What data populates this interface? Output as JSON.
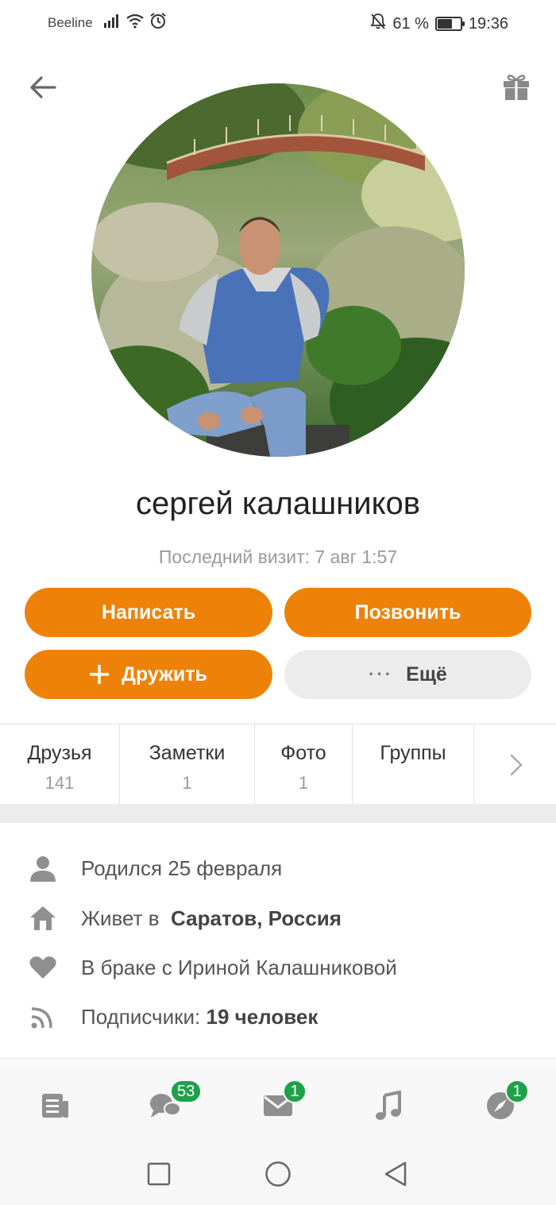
{
  "status_bar": {
    "carrier": "Beeline",
    "battery_percent": "61 %",
    "battery_level": 0.61,
    "time": "19:36"
  },
  "profile": {
    "name": "сергей калашников",
    "last_visit": "Последний визит: 7 авг 1:57"
  },
  "actions": {
    "write": "Написать",
    "call": "Позвонить",
    "befriend": "Дружить",
    "more": "Ещё"
  },
  "tabs": [
    {
      "label": "Друзья",
      "count": "141"
    },
    {
      "label": "Заметки",
      "count": "1"
    },
    {
      "label": "Фото",
      "count": "1"
    },
    {
      "label": "Группы",
      "count": ""
    }
  ],
  "info": {
    "born": "Родился 25 февраля",
    "lives_prefix": "Живет в",
    "lives_city": "Саратов, Россия",
    "married": "В браке с Ириной Калашниковой",
    "subscribers_prefix": "Подписчики:",
    "subscribers_count": "19 человек"
  },
  "bottom_nav": {
    "messages_badge": "53",
    "mail_badge": "1",
    "discover_badge": "1"
  },
  "colors": {
    "accent": "#ee8208",
    "badge": "#1fa14a"
  }
}
